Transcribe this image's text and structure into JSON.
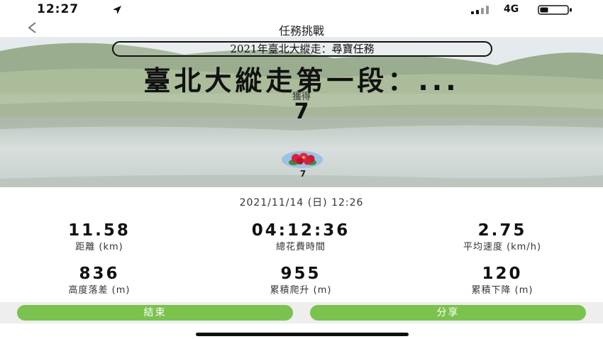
{
  "status_bar": {
    "time": "12:27",
    "network": "4G"
  },
  "nav": {
    "title": "任務挑戰"
  },
  "hero": {
    "event_name": "2021年臺北大縱走：尋寶任務",
    "task_title": "臺北大縱走第一段：...",
    "earned_label": "獲得",
    "earned_value": "7",
    "badge_count": "7"
  },
  "session": {
    "datetime": "2021/11/14 (日) 12:26"
  },
  "stats": [
    {
      "value": "11.58",
      "label": "距離 (km)"
    },
    {
      "value": "04:12:36",
      "label": "總花費時間"
    },
    {
      "value": "2.75",
      "label": "平均速度 (km/h)"
    },
    {
      "value": "836",
      "label": "高度落差 (m)"
    },
    {
      "value": "955",
      "label": "累積爬升 (m)"
    },
    {
      "value": "120",
      "label": "累積下降 (m)"
    }
  ],
  "actions": {
    "end_label": "結束",
    "share_label": "分享"
  },
  "colors": {
    "accent_green": "#7cc24f",
    "action_bar_bg": "#eeeeee"
  },
  "icons": [
    "location-arrow-icon",
    "signal-bars-icon",
    "battery-icon",
    "back-chevron-icon",
    "flower-badge-icon"
  ]
}
